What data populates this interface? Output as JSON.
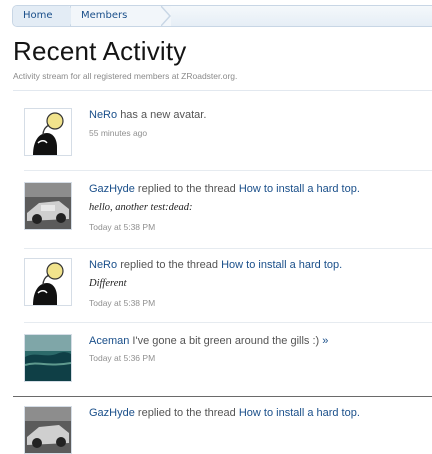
{
  "breadcrumb": {
    "home": "Home",
    "members": "Members"
  },
  "page": {
    "title": "Recent Activity",
    "description": "Activity stream for all registered members at ZRoadster.org."
  },
  "activity": [
    {
      "user": "NeRo",
      "text": "has a new avatar.",
      "link": "",
      "snippet": "",
      "time": "55 minutes ago",
      "avatar_icon": "bald-character-icon"
    },
    {
      "user": "GazHyde",
      "text": "replied to the thread",
      "link": "How to install a hard top.",
      "snippet": "hello, another test:dead:",
      "time": "Today at 5:38 PM",
      "avatar_icon": "car-photo-icon"
    },
    {
      "user": "NeRo",
      "text": "replied to the thread",
      "link": "How to install a hard top.",
      "snippet": "Different",
      "time": "Today at 5:38 PM",
      "avatar_icon": "bald-character-icon"
    },
    {
      "user": "Aceman",
      "text": "I've gone a bit green around the gills :)",
      "link": "»",
      "snippet": "",
      "time": "Today at 5:36 PM",
      "avatar_icon": "landscape-photo-icon"
    },
    {
      "user": "GazHyde",
      "text": "replied to the thread",
      "link": "How to install a hard top.",
      "snippet": "",
      "time": "",
      "avatar_icon": "car-photo-icon"
    }
  ]
}
